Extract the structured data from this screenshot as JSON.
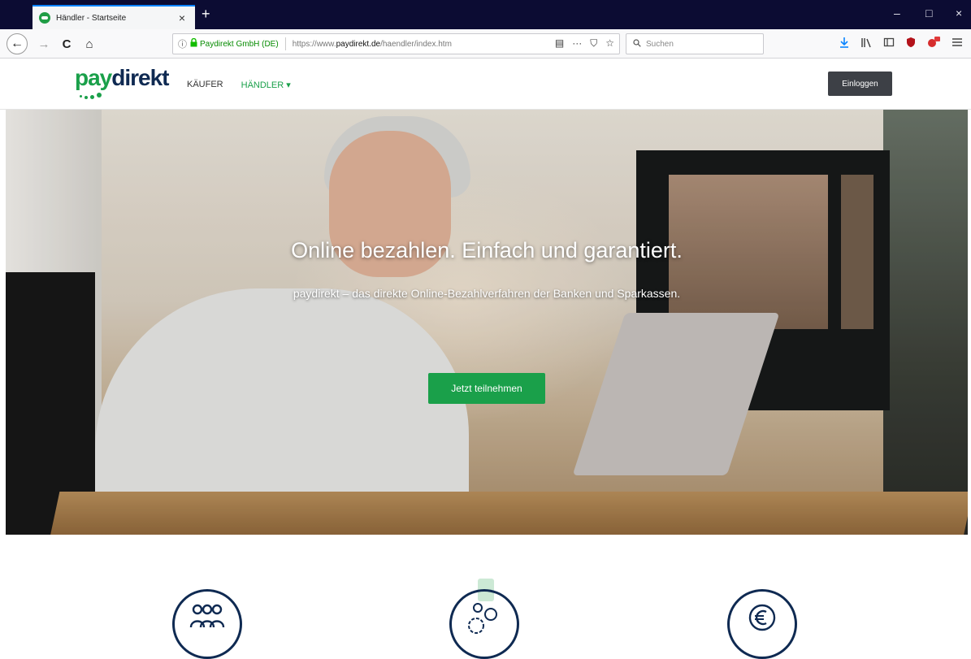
{
  "browser": {
    "tab_title": "Händler - Startseite",
    "tab_close": "×",
    "new_tab": "+",
    "window_controls": {
      "minimize": "–",
      "maximize": "□",
      "close": "×"
    },
    "nav": {
      "back": "←",
      "forward": "→",
      "reload": "C",
      "home": "⌂"
    },
    "urlbar": {
      "info_icon": "ⓘ",
      "identity": "Paydirekt GmbH (DE)",
      "url_prefix": "https://www.",
      "url_host": "paydirekt.de",
      "url_path": "/haendler/index.htm",
      "reader_icon": "▤",
      "more_icon": "···",
      "pocket_icon": "⛉",
      "bookmark_icon": "☆"
    },
    "search": {
      "placeholder": "Suchen"
    },
    "toolbar_icons": [
      "download-icon",
      "library-icon",
      "sidebar-icon",
      "ublock-icon",
      "extension-icon",
      "menu-icon"
    ],
    "accent": "#0a84ff"
  },
  "site": {
    "logo": {
      "pay": "pay",
      "direkt": "direkt"
    },
    "nav": {
      "kaeufer": "KÄUFER",
      "haendler": "HÄNDLER ▾"
    },
    "login": "Einloggen",
    "colors": {
      "brand_green": "#1aa04a",
      "brand_navy": "#0f2a52"
    }
  },
  "hero": {
    "title": "Online bezahlen. Einfach und garantiert.",
    "subtitle": "paydirekt – das direkte Online-Bezahlverfahren der Banken und Sparkassen.",
    "cta": "Jetzt teilnehmen"
  },
  "features": [
    {
      "icon": "people-icon"
    },
    {
      "icon": "gears-icon"
    },
    {
      "icon": "euro-icon"
    }
  ]
}
